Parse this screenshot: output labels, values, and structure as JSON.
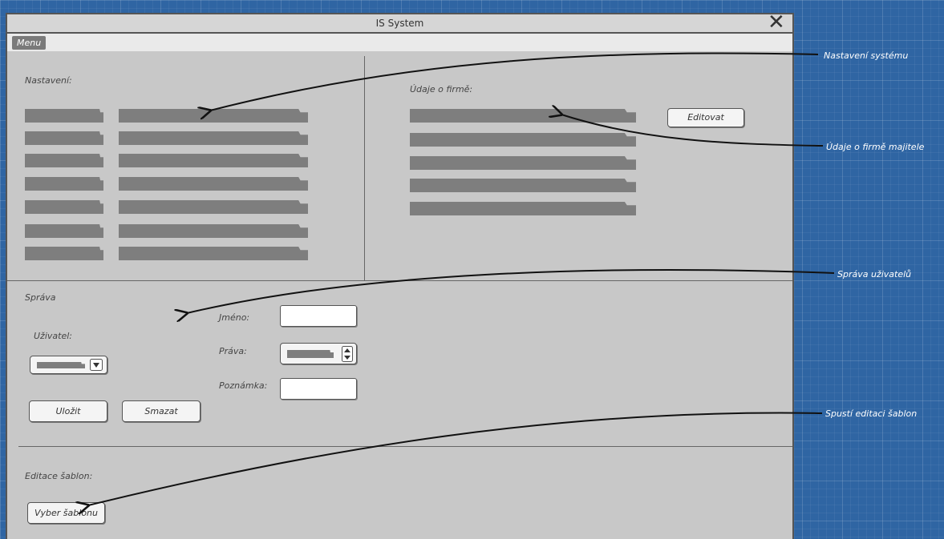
{
  "window": {
    "title": "IS System"
  },
  "menu": {
    "label": "Menu"
  },
  "settings": {
    "label": "Nastavení:"
  },
  "company": {
    "label": "Údaje o firmě:",
    "edit_button": "Editovat"
  },
  "admin": {
    "label": "Správa",
    "user_label": "Uživatel:",
    "name_label": "Jméno:",
    "rights_label": "Práva:",
    "note_label": "Poznámka:",
    "save_button": "Uložit",
    "delete_button": "Smazat"
  },
  "templates": {
    "label": "Editace šablon:",
    "select_button": "Vyber šablonu"
  },
  "annotations": {
    "settings": "Nastavení systému",
    "company": "Údaje o firmě majitele",
    "users": "Správa uživatelů",
    "templates": "Spustí editaci šablon"
  },
  "icons": {
    "close": "close-icon",
    "combo_down": "chevron-down-icon",
    "spinner": "up-down-icon"
  },
  "colors": {
    "canvas": "#2f65a3",
    "window": "#c8c8c8",
    "placeholder_bar": "#7e7e7e"
  }
}
